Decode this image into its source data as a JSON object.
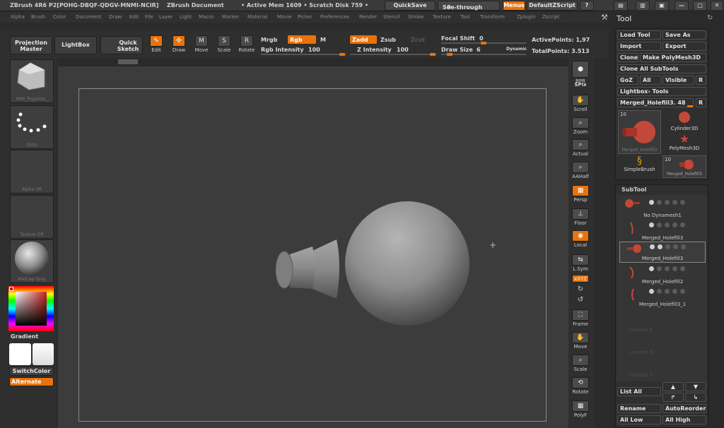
{
  "titlebar": {
    "app": "ZBrush 4R6 P2[POHG-DBQF-QDGV-MNMI-NCIR]",
    "doc": "ZBrush Document",
    "mem": "• Active Mem 1609 • Scratch Disk 759 •",
    "quicksave": "QuickSave",
    "seethrough": "See-through",
    "seethrough_value": "0",
    "menus": "Menus",
    "zscript": "DefaultZScript"
  },
  "menubar": [
    "Alpha",
    "Brush",
    "Color",
    "Document",
    "Draw",
    "Edit",
    "File",
    "Layer",
    "Light",
    "Macro",
    "Marker",
    "Material",
    "Movie",
    "Picker",
    "Preferences",
    "Render",
    "Stencil",
    "Stroke",
    "Texture",
    "Tool",
    "Transform",
    "Zplugin",
    "Zscript"
  ],
  "toolbar": {
    "projection_master": "Projection Master",
    "lightbox": "LightBox",
    "quick_sketch": "Quick Sketch",
    "modes": [
      "Edit",
      "Draw",
      "Move",
      "Scale",
      "Rotate"
    ],
    "mrgb": "Mrgb",
    "rgb": "Rgb",
    "m": "M",
    "rgb_intensity_label": "Rgb Intensity",
    "rgb_intensity": "100",
    "zadd": "Zadd",
    "zsub": "Zsub",
    "zcut": "Zcut",
    "z_intensity_label": "Z Intensity",
    "z_intensity": "100",
    "focal_shift_label": "Focal Shift",
    "focal_shift": "0",
    "draw_size_label": "Draw Size",
    "draw_size": "6",
    "dynamic": "Dynamic",
    "active_points": "ActivePoints: 1,97",
    "total_points": "TotalPoints: 3.513"
  },
  "left": {
    "brush_caption": "IMM_ToyJoints_",
    "stroke_caption": "Dots",
    "alpha_caption": "Alpha Off",
    "texture_caption": "Texture Off",
    "material_caption": "MatCap Gray",
    "gradient": "Gradient",
    "switchcolor": "SwitchColor",
    "alternate": "Alternate"
  },
  "shelf": [
    "BPR",
    "SPix",
    "Scroll",
    "Zoom",
    "Actual",
    "AAHalf",
    "Persp",
    "Floor",
    "Local",
    "L.Sym",
    "xXYZ",
    "Frame",
    "Move",
    "Scale",
    "Rotate",
    "PolyF"
  ],
  "tool": {
    "title": "Tool",
    "load_tool": "Load Tool",
    "save_as": "Save As",
    "import": "Import",
    "export": "Export",
    "clone": "Clone",
    "make_polymesh": "Make PolyMesh3D",
    "clone_all": "Clone All SubTools",
    "goz": "GoZ",
    "all": "All",
    "visible": "Visible",
    "r": "R",
    "lightbox_tools": "Lightbox› Tools",
    "current_tool": "Merged_Holefill3. 48",
    "thumbs": [
      "Merged_Holefill3",
      "Cylinder3D",
      "PolyMesh3D",
      "SimpleBrush",
      "Merged_Holefill3"
    ],
    "thumb_counts": [
      "10",
      "10"
    ]
  },
  "subtool": {
    "title": "SubTool",
    "items": [
      "No Dynamesh1",
      "Merged_Holefill3",
      "Merged_Holefill3",
      "Merged_Holefill2",
      "Merged_Holefill3_1"
    ],
    "empty": [
      "Unused 5",
      "Unused 6",
      "Unused 7"
    ],
    "list_all": "List All",
    "rename": "Rename",
    "autoreorder": "AutoReorder",
    "all_low": "All Low",
    "all_high": "All High"
  },
  "colors": {
    "accent": "#e8720c",
    "panel": "#2f2f2f",
    "canvas": "#3c3c3c"
  }
}
